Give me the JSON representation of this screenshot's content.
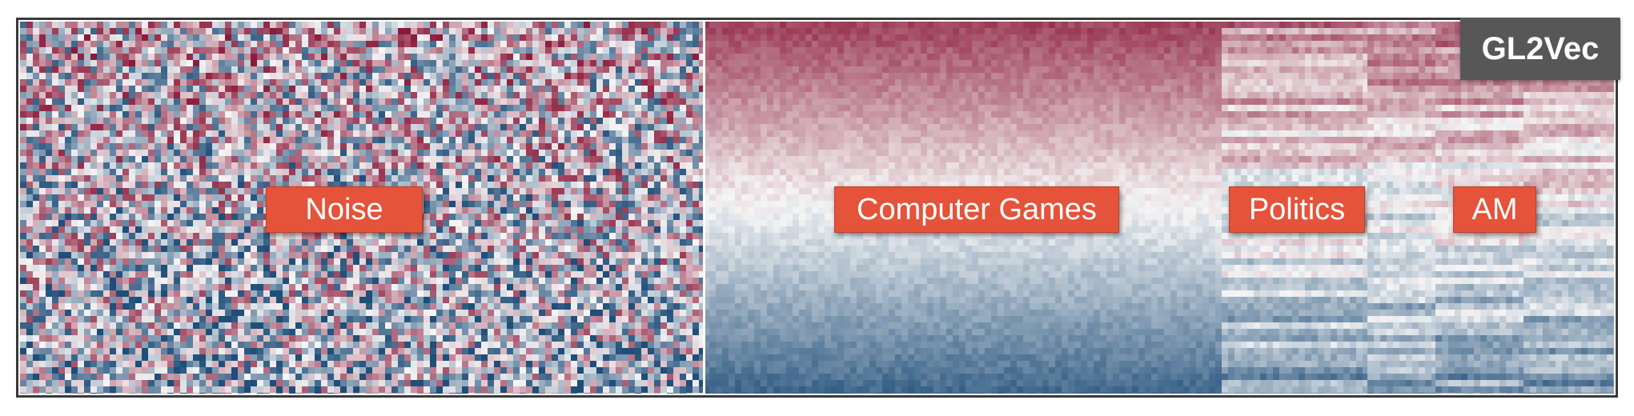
{
  "chart_data": {
    "type": "heatmap",
    "title": "GL2Vec",
    "segments": [
      {
        "label": "Noise",
        "pattern": "random"
      },
      {
        "label": "Computer Games",
        "pattern": "row-gradient"
      },
      {
        "label": "Politics",
        "pattern": "row-banded"
      },
      {
        "label": "",
        "pattern": "row-banded"
      },
      {
        "label": "AM",
        "pattern": "row-banded"
      },
      {
        "label": "",
        "pattern": "row-banded"
      }
    ],
    "colorscale": {
      "low": "#1f4e79",
      "mid": "#f5f5f5",
      "high": "#8b1a3a"
    },
    "rows_sorted": "descending",
    "grid": false,
    "legend": "none"
  },
  "colors": {
    "label_background": "#e4533a",
    "label_text": "#ffffff",
    "badge_background": "#575757",
    "frame": "#3a3a3a"
  }
}
